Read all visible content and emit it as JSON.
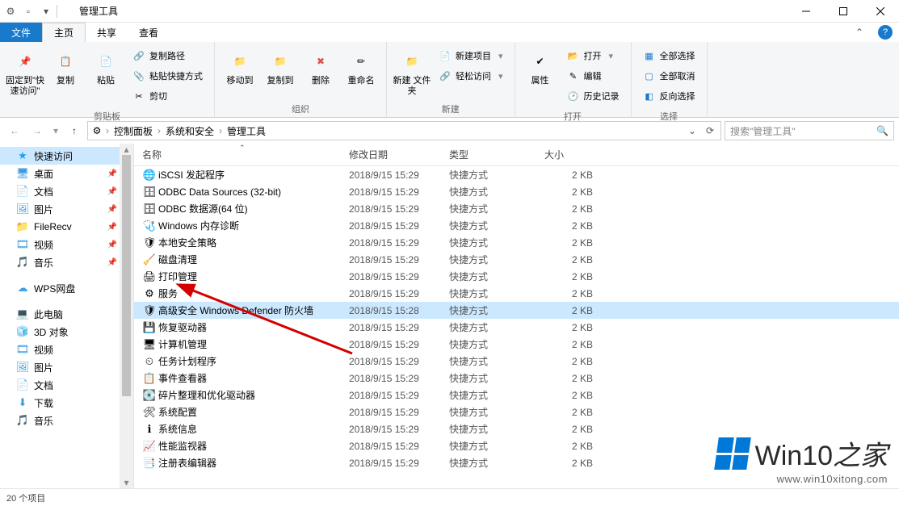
{
  "title": "管理工具",
  "tabs": {
    "file": "文件",
    "home": "主页",
    "share": "共享",
    "view": "查看"
  },
  "ribbon": {
    "pin": "固定到\"快\n速访问\"",
    "copy": "复制",
    "paste": "粘贴",
    "copy_path": "复制路径",
    "paste_shortcut": "粘贴快捷方式",
    "cut": "剪切",
    "clipboard_group": "剪贴板",
    "move_to": "移动到",
    "copy_to": "复制到",
    "delete": "删除",
    "rename": "重命名",
    "organize_group": "组织",
    "new_folder": "新建\n文件夹",
    "new_item": "新建项目",
    "easy_access": "轻松访问",
    "new_group": "新建",
    "properties": "属性",
    "open": "打开",
    "edit": "编辑",
    "history": "历史记录",
    "open_group": "打开",
    "select_all": "全部选择",
    "select_none": "全部取消",
    "invert": "反向选择",
    "select_group": "选择"
  },
  "breadcrumb": [
    "控制面板",
    "系统和安全",
    "管理工具"
  ],
  "search_placeholder": "搜索\"管理工具\"",
  "columns": {
    "name": "名称",
    "date": "修改日期",
    "type": "类型",
    "size": "大小"
  },
  "sidebar": [
    {
      "label": "快速访问",
      "icon": "star",
      "sel": true,
      "color": "#fff",
      "bg": "#1e9fff"
    },
    {
      "label": "桌面",
      "icon": "desktop",
      "pin": true,
      "color": "#3a9de0"
    },
    {
      "label": "文档",
      "icon": "doc",
      "pin": true,
      "color": "#3a9de0"
    },
    {
      "label": "图片",
      "icon": "pic",
      "pin": true,
      "color": "#3a9de0"
    },
    {
      "label": "FileRecv",
      "icon": "folder",
      "pin": true,
      "color": "#f0c450"
    },
    {
      "label": "视频",
      "icon": "video",
      "pin": true,
      "color": "#3a9de0"
    },
    {
      "label": "音乐",
      "icon": "music",
      "pin": true,
      "color": "#3a9de0"
    },
    {
      "sep": true
    },
    {
      "label": "WPS网盘",
      "icon": "cloud",
      "color": "#3aa0e8"
    },
    {
      "sep": true
    },
    {
      "label": "此电脑",
      "icon": "pc",
      "color": "#3a9de0"
    },
    {
      "label": "3D 对象",
      "icon": "3d",
      "color": "#20a060"
    },
    {
      "label": "视频",
      "icon": "video",
      "color": "#3a9de0"
    },
    {
      "label": "图片",
      "icon": "pic",
      "color": "#3a9de0"
    },
    {
      "label": "文档",
      "icon": "doc",
      "color": "#3a9de0"
    },
    {
      "label": "下载",
      "icon": "download",
      "color": "#3a9de0"
    },
    {
      "label": "音乐",
      "icon": "music",
      "color": "#3a9de0"
    }
  ],
  "files": [
    {
      "n": "iSCSI 发起程序",
      "d": "2018/9/15 15:29",
      "t": "快捷方式",
      "s": "2 KB"
    },
    {
      "n": "ODBC Data Sources (32-bit)",
      "d": "2018/9/15 15:29",
      "t": "快捷方式",
      "s": "2 KB"
    },
    {
      "n": "ODBC 数据源(64 位)",
      "d": "2018/9/15 15:29",
      "t": "快捷方式",
      "s": "2 KB"
    },
    {
      "n": "Windows 内存诊断",
      "d": "2018/9/15 15:29",
      "t": "快捷方式",
      "s": "2 KB"
    },
    {
      "n": "本地安全策略",
      "d": "2018/9/15 15:29",
      "t": "快捷方式",
      "s": "2 KB"
    },
    {
      "n": "磁盘清理",
      "d": "2018/9/15 15:29",
      "t": "快捷方式",
      "s": "2 KB"
    },
    {
      "n": "打印管理",
      "d": "2018/9/15 15:29",
      "t": "快捷方式",
      "s": "2 KB"
    },
    {
      "n": "服务",
      "d": "2018/9/15 15:29",
      "t": "快捷方式",
      "s": "2 KB"
    },
    {
      "n": "高级安全 Windows Defender 防火墙",
      "d": "2018/9/15 15:28",
      "t": "快捷方式",
      "s": "2 KB",
      "sel": true
    },
    {
      "n": "恢复驱动器",
      "d": "2018/9/15 15:29",
      "t": "快捷方式",
      "s": "2 KB"
    },
    {
      "n": "计算机管理",
      "d": "2018/9/15 15:29",
      "t": "快捷方式",
      "s": "2 KB"
    },
    {
      "n": "任务计划程序",
      "d": "2018/9/15 15:29",
      "t": "快捷方式",
      "s": "2 KB"
    },
    {
      "n": "事件查看器",
      "d": "2018/9/15 15:29",
      "t": "快捷方式",
      "s": "2 KB"
    },
    {
      "n": "碎片整理和优化驱动器",
      "d": "2018/9/15 15:29",
      "t": "快捷方式",
      "s": "2 KB"
    },
    {
      "n": "系统配置",
      "d": "2018/9/15 15:29",
      "t": "快捷方式",
      "s": "2 KB"
    },
    {
      "n": "系统信息",
      "d": "2018/9/15 15:29",
      "t": "快捷方式",
      "s": "2 KB"
    },
    {
      "n": "性能监视器",
      "d": "2018/9/15 15:29",
      "t": "快捷方式",
      "s": "2 KB"
    },
    {
      "n": "注册表编辑器",
      "d": "2018/9/15 15:29",
      "t": "快捷方式",
      "s": "2 KB"
    }
  ],
  "status": "20 个项目",
  "watermark": {
    "brand": "Win10",
    "suffix": "之家",
    "url": "www.win10xitong.com"
  }
}
